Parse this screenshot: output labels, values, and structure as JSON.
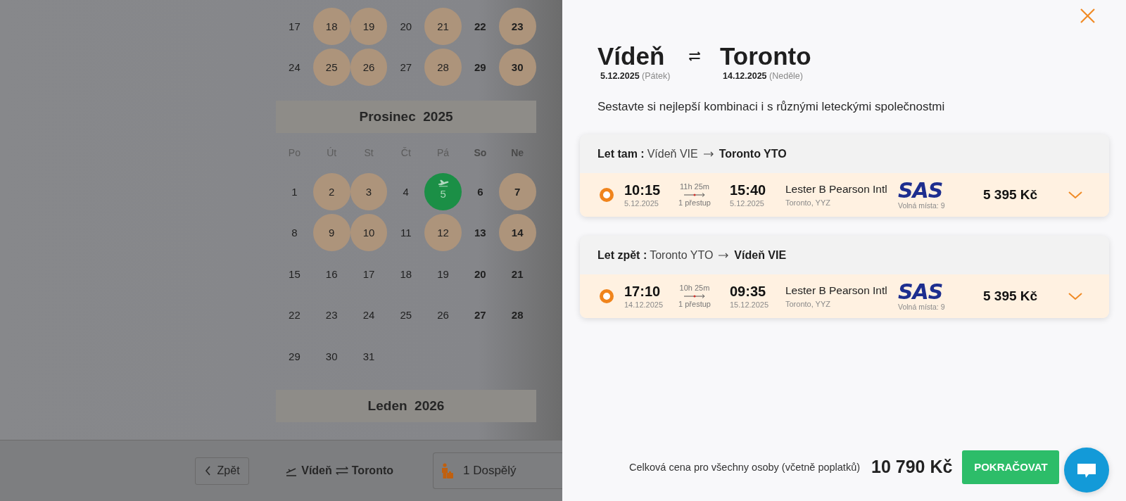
{
  "calendar": {
    "months": [
      {
        "weeks": [
          [
            {
              "day": "17",
              "available": false,
              "selected": false
            },
            {
              "day": "18",
              "available": true,
              "selected": false
            },
            {
              "day": "19",
              "available": true,
              "selected": false
            },
            {
              "day": "20",
              "available": false,
              "selected": false
            },
            {
              "day": "21",
              "available": true,
              "selected": false
            },
            {
              "day": "22",
              "available": false,
              "selected": false
            },
            {
              "day": "23",
              "available": true,
              "selected": false
            }
          ],
          [
            {
              "day": "24",
              "available": false,
              "selected": false
            },
            {
              "day": "25",
              "available": true,
              "selected": false
            },
            {
              "day": "26",
              "available": true,
              "selected": false
            },
            {
              "day": "27",
              "available": false,
              "selected": false
            },
            {
              "day": "28",
              "available": true,
              "selected": false
            },
            {
              "day": "29",
              "available": false,
              "selected": false
            },
            {
              "day": "30",
              "available": true,
              "selected": false
            }
          ]
        ]
      },
      {
        "title": "Prosinec  2025",
        "weekdays": [
          "Po",
          "Út",
          "St",
          "Čt",
          "Pá",
          "So",
          "Ne"
        ],
        "weeks": [
          [
            {
              "day": "1",
              "available": false,
              "selected": false
            },
            {
              "day": "2",
              "available": true,
              "selected": false
            },
            {
              "day": "3",
              "available": true,
              "selected": false
            },
            {
              "day": "4",
              "available": false,
              "selected": false
            },
            {
              "day": "5",
              "available": true,
              "selected": true
            },
            {
              "day": "6",
              "available": false,
              "selected": false
            },
            {
              "day": "7",
              "available": true,
              "selected": false
            }
          ],
          [
            {
              "day": "8",
              "available": false,
              "selected": false
            },
            {
              "day": "9",
              "available": true,
              "selected": false
            },
            {
              "day": "10",
              "available": true,
              "selected": false
            },
            {
              "day": "11",
              "available": false,
              "selected": false
            },
            {
              "day": "12",
              "available": true,
              "selected": false
            },
            {
              "day": "13",
              "available": false,
              "selected": false
            },
            {
              "day": "14",
              "available": true,
              "selected": false
            }
          ],
          [
            {
              "day": "15",
              "available": false,
              "selected": false
            },
            {
              "day": "16",
              "available": false,
              "selected": false
            },
            {
              "day": "17",
              "available": false,
              "selected": false
            },
            {
              "day": "18",
              "available": false,
              "selected": false
            },
            {
              "day": "19",
              "available": false,
              "selected": false
            },
            {
              "day": "20",
              "available": false,
              "selected": false
            },
            {
              "day": "21",
              "available": false,
              "selected": false
            }
          ],
          [
            {
              "day": "22",
              "available": false,
              "selected": false
            },
            {
              "day": "23",
              "available": false,
              "selected": false
            },
            {
              "day": "24",
              "available": false,
              "selected": false
            },
            {
              "day": "25",
              "available": false,
              "selected": false
            },
            {
              "day": "26",
              "available": false,
              "selected": false
            },
            {
              "day": "27",
              "available": false,
              "selected": false
            },
            {
              "day": "28",
              "available": false,
              "selected": false
            }
          ],
          [
            {
              "day": "29",
              "available": false,
              "selected": false
            },
            {
              "day": "30",
              "available": false,
              "selected": false
            },
            {
              "day": "31",
              "available": false,
              "selected": false
            }
          ]
        ]
      },
      {
        "title": "Leden  2026"
      }
    ]
  },
  "bottom_bar": {
    "back_button": "Zpět",
    "route": {
      "from": "Vídeň",
      "to": "Toronto"
    },
    "passengers": "1 Dospělý"
  },
  "panel": {
    "trip": {
      "from": "Vídeň",
      "from_date": "5.12.2025",
      "from_day": "(Pátek)",
      "to": "Toronto",
      "to_date": "14.12.2025",
      "to_day": "(Neděle)"
    },
    "subtitle": "Sestavte si nejlepší kombinaci i s různými leteckými společnostmi",
    "flights": [
      {
        "label": "Let tam :",
        "from": "Vídeň VIE",
        "to": "Toronto YTO",
        "selected": true,
        "depart_time": "10:15",
        "depart_date": "5.12.2025",
        "duration": "11h 25m",
        "stops": "1 přestup",
        "arrive_time": "15:40",
        "arrive_date": "5.12.2025",
        "airport": "Lester B Pearson Intl",
        "city": "Toronto, YYZ",
        "airline": "SAS",
        "seats": "Volná místa: 9",
        "price": "5 395 Kč"
      },
      {
        "label": "Let zpět :",
        "from": "Toronto YTO",
        "to": "Vídeň VIE",
        "selected": true,
        "depart_time": "17:10",
        "depart_date": "14.12.2025",
        "duration": "10h 25m",
        "stops": "1 přestup",
        "arrive_time": "09:35",
        "arrive_date": "15.12.2025",
        "airport": "Lester B Pearson Intl",
        "city": "Toronto, YYZ",
        "airline": "SAS",
        "seats": "Volná místa: 9",
        "price": "5 395 Kč"
      }
    ],
    "total": {
      "label": "Celková cena pro všechny osoby (včetně poplatků)",
      "price": "10 790 Kč"
    },
    "continue_button": "POKRAČOVAT"
  }
}
